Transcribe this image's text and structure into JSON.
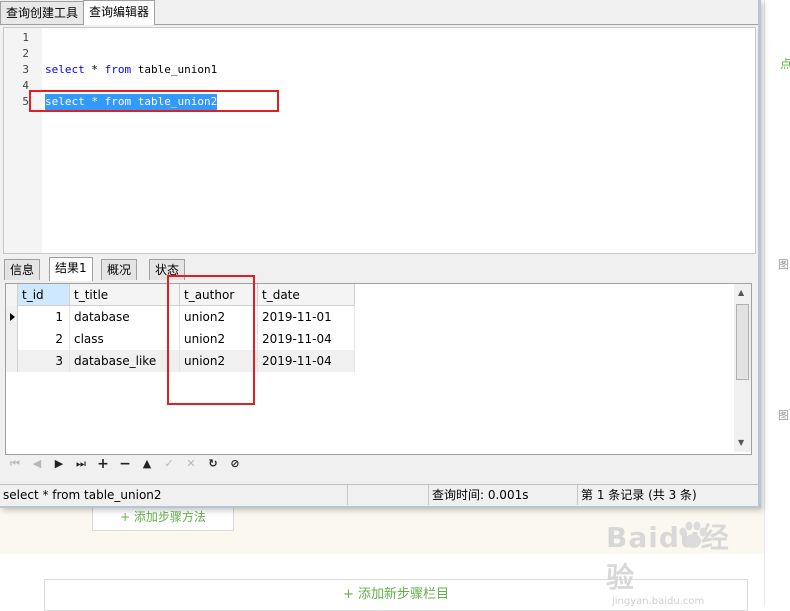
{
  "window": {
    "tabs": [
      "查询创建工具",
      "查询编辑器"
    ],
    "active_tab": "查询编辑器"
  },
  "editor": {
    "line_numbers": [
      "1",
      "2",
      "3",
      "4",
      "5"
    ],
    "lines": [
      {
        "kw1": "select",
        "mid": " * ",
        "kw2": "from",
        "rest": " table_union1"
      },
      {
        "kw1": "select",
        "mid": " * ",
        "kw2": "from",
        "rest": " table_union2"
      }
    ],
    "selected_line": 5
  },
  "result_tabs": [
    "信息",
    "结果1",
    "概况",
    "状态"
  ],
  "active_result_tab": "结果1",
  "grid": {
    "columns": [
      "t_id",
      "t_title",
      "t_author",
      "t_date"
    ],
    "rows": [
      {
        "t_id": "1",
        "t_title": "database",
        "t_author": "union2",
        "t_date": "2019-11-01"
      },
      {
        "t_id": "2",
        "t_title": "class",
        "t_author": "union2",
        "t_date": "2019-11-04"
      },
      {
        "t_id": "3",
        "t_title": "database_like",
        "t_author": "union2",
        "t_date": "2019-11-04"
      }
    ],
    "current_row": 1
  },
  "nav_bar": {
    "icons": [
      "first-icon",
      "prev-icon",
      "next-icon",
      "last-icon",
      "add-icon",
      "delete-icon",
      "move-up-icon",
      "apply-icon",
      "discard-icon",
      "refresh-icon",
      "stop-icon"
    ]
  },
  "status_bar": {
    "sql": "select * from table_union2",
    "time": "查询时间: 0.001s",
    "records": "第 1 条记录 (共 3 条)"
  },
  "background_page": {
    "add_step_method": "+ 添加步骤方法",
    "add_step_section": "+ 添加新步骤栏目",
    "right_text1": "点",
    "right_text2": "图",
    "right_text3": "图",
    "watermark_main": "Baidu经验",
    "watermark_sub": "jingyan.baidu.com"
  },
  "colors": {
    "annotation_red": "#e02020",
    "selection_blue": "#3399ff",
    "keyword_blue": "#0000ff",
    "link_green": "#63b04a"
  }
}
